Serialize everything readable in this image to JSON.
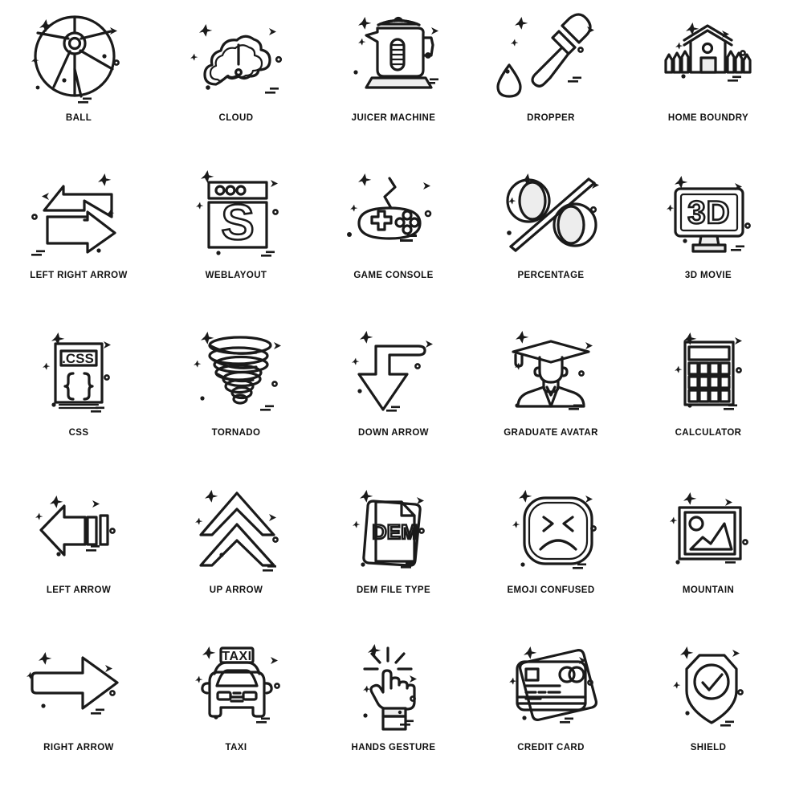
{
  "sheet": {
    "title": "Icon Set Sheet",
    "columns": 5,
    "rows": 5,
    "stroke_color": "#1a1a1a",
    "background_color": "#ffffff",
    "shade_color": "#ededed"
  },
  "decorations": {
    "star_top_left": "four-point-star",
    "chevron_top_right": "small-right-chevron",
    "sparkle_left": "tiny-sparkle",
    "circle_right": "small-circle-outline",
    "dot_bottom_left": "tiny-dot",
    "dashes_bottom_right": "two-short-dashes"
  },
  "icons": [
    {
      "label": "BALL",
      "name": "ball",
      "inline_text": ""
    },
    {
      "label": "CLOUD",
      "name": "cloud",
      "inline_text": ""
    },
    {
      "label": "JUICER MACHINE",
      "name": "juicer-machine",
      "inline_text": ""
    },
    {
      "label": "DROPPER",
      "name": "dropper",
      "inline_text": ""
    },
    {
      "label": "HOME BOUNDRY",
      "name": "home-boundry",
      "inline_text": ""
    },
    {
      "label": "LEFT RIGHT ARROW",
      "name": "left-right-arrow",
      "inline_text": ""
    },
    {
      "label": "WEBLAYOUT",
      "name": "weblayout",
      "inline_text": "S"
    },
    {
      "label": "GAME CONSOLE",
      "name": "game-console",
      "inline_text": ""
    },
    {
      "label": "PERCENTAGE",
      "name": "percentage",
      "inline_text": ""
    },
    {
      "label": "3D MOVIE",
      "name": "3d-movie",
      "inline_text": "3D"
    },
    {
      "label": "CSS",
      "name": "css",
      "inline_text": ".CSS"
    },
    {
      "label": "TORNADO",
      "name": "tornado",
      "inline_text": ""
    },
    {
      "label": "DOWN ARROW",
      "name": "down-arrow",
      "inline_text": ""
    },
    {
      "label": "GRADUATE AVATAR",
      "name": "graduate-avatar",
      "inline_text": ""
    },
    {
      "label": "CALCULATOR",
      "name": "calculator",
      "inline_text": ""
    },
    {
      "label": "LEFT ARROW",
      "name": "left-arrow",
      "inline_text": ""
    },
    {
      "label": "UP ARROW",
      "name": "up-arrow",
      "inline_text": ""
    },
    {
      "label": "DEM FILE TYPE",
      "name": "dem-file-type",
      "inline_text": "DEM"
    },
    {
      "label": "EMOJI CONFUSED",
      "name": "emoji-confused",
      "inline_text": ""
    },
    {
      "label": "MOUNTAIN",
      "name": "mountain",
      "inline_text": ""
    },
    {
      "label": "RIGHT ARROW",
      "name": "right-arrow",
      "inline_text": ""
    },
    {
      "label": "TAXI",
      "name": "taxi",
      "inline_text": "TAXI"
    },
    {
      "label": "HANDS GESTURE",
      "name": "hands-gesture",
      "inline_text": ""
    },
    {
      "label": "CREDIT CARD",
      "name": "credit-card",
      "inline_text": ""
    },
    {
      "label": "SHIELD",
      "name": "shield",
      "inline_text": ""
    }
  ]
}
